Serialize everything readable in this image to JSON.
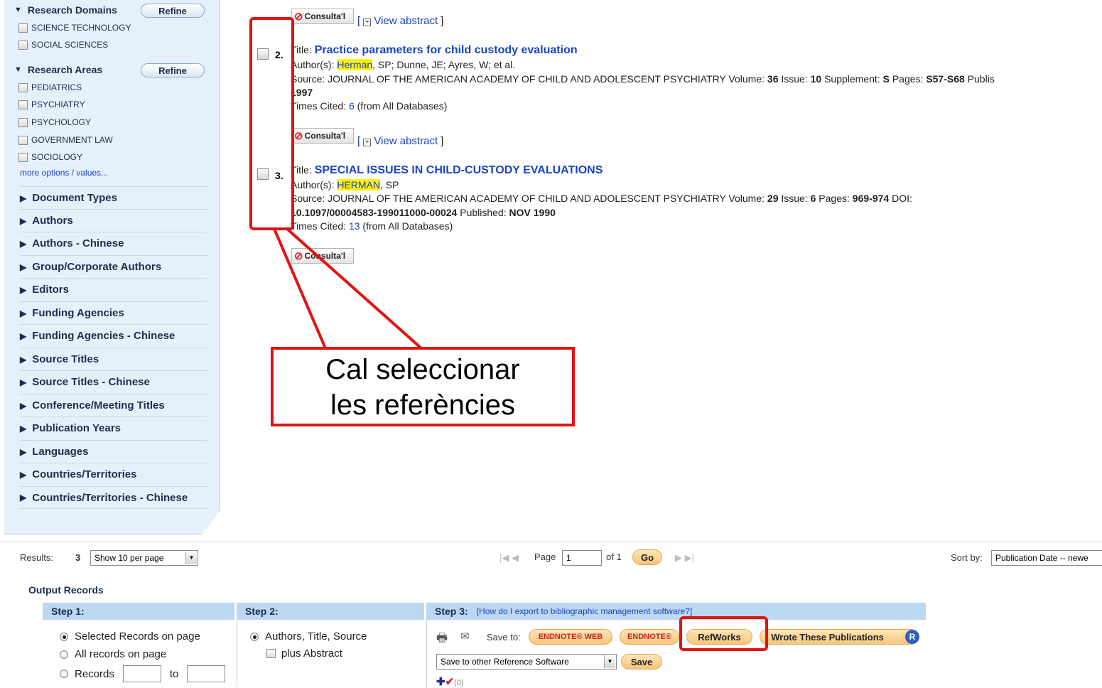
{
  "sidebar": {
    "research_domains": {
      "label": "Research Domains",
      "refine": "Refine",
      "options": [
        "SCIENCE TECHNOLOGY",
        "SOCIAL SCIENCES"
      ]
    },
    "research_areas": {
      "label": "Research Areas",
      "refine": "Refine",
      "options": [
        "PEDIATRICS",
        "PSYCHIATRY",
        "PSYCHOLOGY",
        "GOVERNMENT LAW",
        "SOCIOLOGY"
      ]
    },
    "more_options": "more options / values...",
    "collapsed_facets": [
      "Document Types",
      "Authors",
      "Authors - Chinese",
      "Group/Corporate Authors",
      "Editors",
      "Funding Agencies",
      "Funding Agencies - Chinese",
      "Source Titles",
      "Source Titles - Chinese",
      "Conference/Meeting Titles",
      "Publication Years",
      "Languages",
      "Countries/Territories",
      "Countries/Territories - Chinese"
    ]
  },
  "records": {
    "consulta_label": "Consulta'l",
    "view_abstract": "View abstract",
    "r2": {
      "num": "2.",
      "title_prefix": "Title: ",
      "title": "Practice parameters for child custody evaluation",
      "authors_prefix": "Author(s): ",
      "author_hl": "Herman",
      "authors_rest": ", SP; Dunne, JE; Ayres, W; et al.",
      "source_prefix": "Source: JOURNAL OF THE AMERICAN ACADEMY OF CHILD AND ADOLESCENT PSYCHIATRY  Volume: ",
      "volume": "36",
      "issue_label": "  Issue: ",
      "issue": "10",
      "supp_label": "  Supplement: ",
      "supp": "S",
      "pages_label": "  Pages: ",
      "pages": "S57-S68",
      "published_label": "  Publis",
      "year": "1997",
      "cited_prefix": "Times Cited: ",
      "cited": "6",
      "cited_suffix": " (from All Databases)"
    },
    "r3": {
      "num": "3.",
      "title_prefix": "Title: ",
      "title": "SPECIAL ISSUES IN CHILD-CUSTODY EVALUATIONS",
      "authors_prefix": "Author(s): ",
      "author_hl": "HERMAN",
      "authors_rest": ", SP",
      "source_prefix": "Source: JOURNAL OF THE AMERICAN ACADEMY OF CHILD AND ADOLESCENT PSYCHIATRY  Volume: ",
      "volume": "29",
      "issue_label": "  Issue: ",
      "issue": "6",
      "pages_label": "  Pages: ",
      "pages": "969-974",
      "doi_label": "  DOI:",
      "doi": "10.1097/00004583-199011000-00024",
      "published_label": "  Published: ",
      "published": "NOV 1990",
      "cited_prefix": "Times Cited: ",
      "cited": "13",
      "cited_suffix": " (from All Databases)"
    }
  },
  "annotation": {
    "line1": "Cal seleccionar",
    "line2": "les referències",
    "color": "#e31212"
  },
  "results_bar": {
    "results_label": "Results:",
    "results_count": "3",
    "per_page": "Show 10 per page",
    "page_label": "Page",
    "page_value": "1",
    "of_label": "of 1",
    "go": "Go",
    "sort_label": "Sort by:",
    "sort_value": "Publication Date -- newe"
  },
  "output": {
    "title": "Output Records",
    "step1": "Step 1:",
    "step2": "Step 2:",
    "step3": "Step 3:",
    "step3_link": "[How do I export to bibliographic management software?]",
    "step1_options": [
      "Selected Records on page",
      "All records on page",
      "Records"
    ],
    "to_label": "to",
    "step2_option": "Authors, Title, Source",
    "step2_check": "plus Abstract",
    "save_to": "Save to:",
    "endnote_web": "ENDNOTE® WEB",
    "endnote": "ENDNOTE®",
    "refworks": "RefWorks",
    "wrote": "I Wrote These Publications",
    "r_badge": "R",
    "other_software": "Save to other Reference Software",
    "save": "Save",
    "marked": "(0)"
  }
}
